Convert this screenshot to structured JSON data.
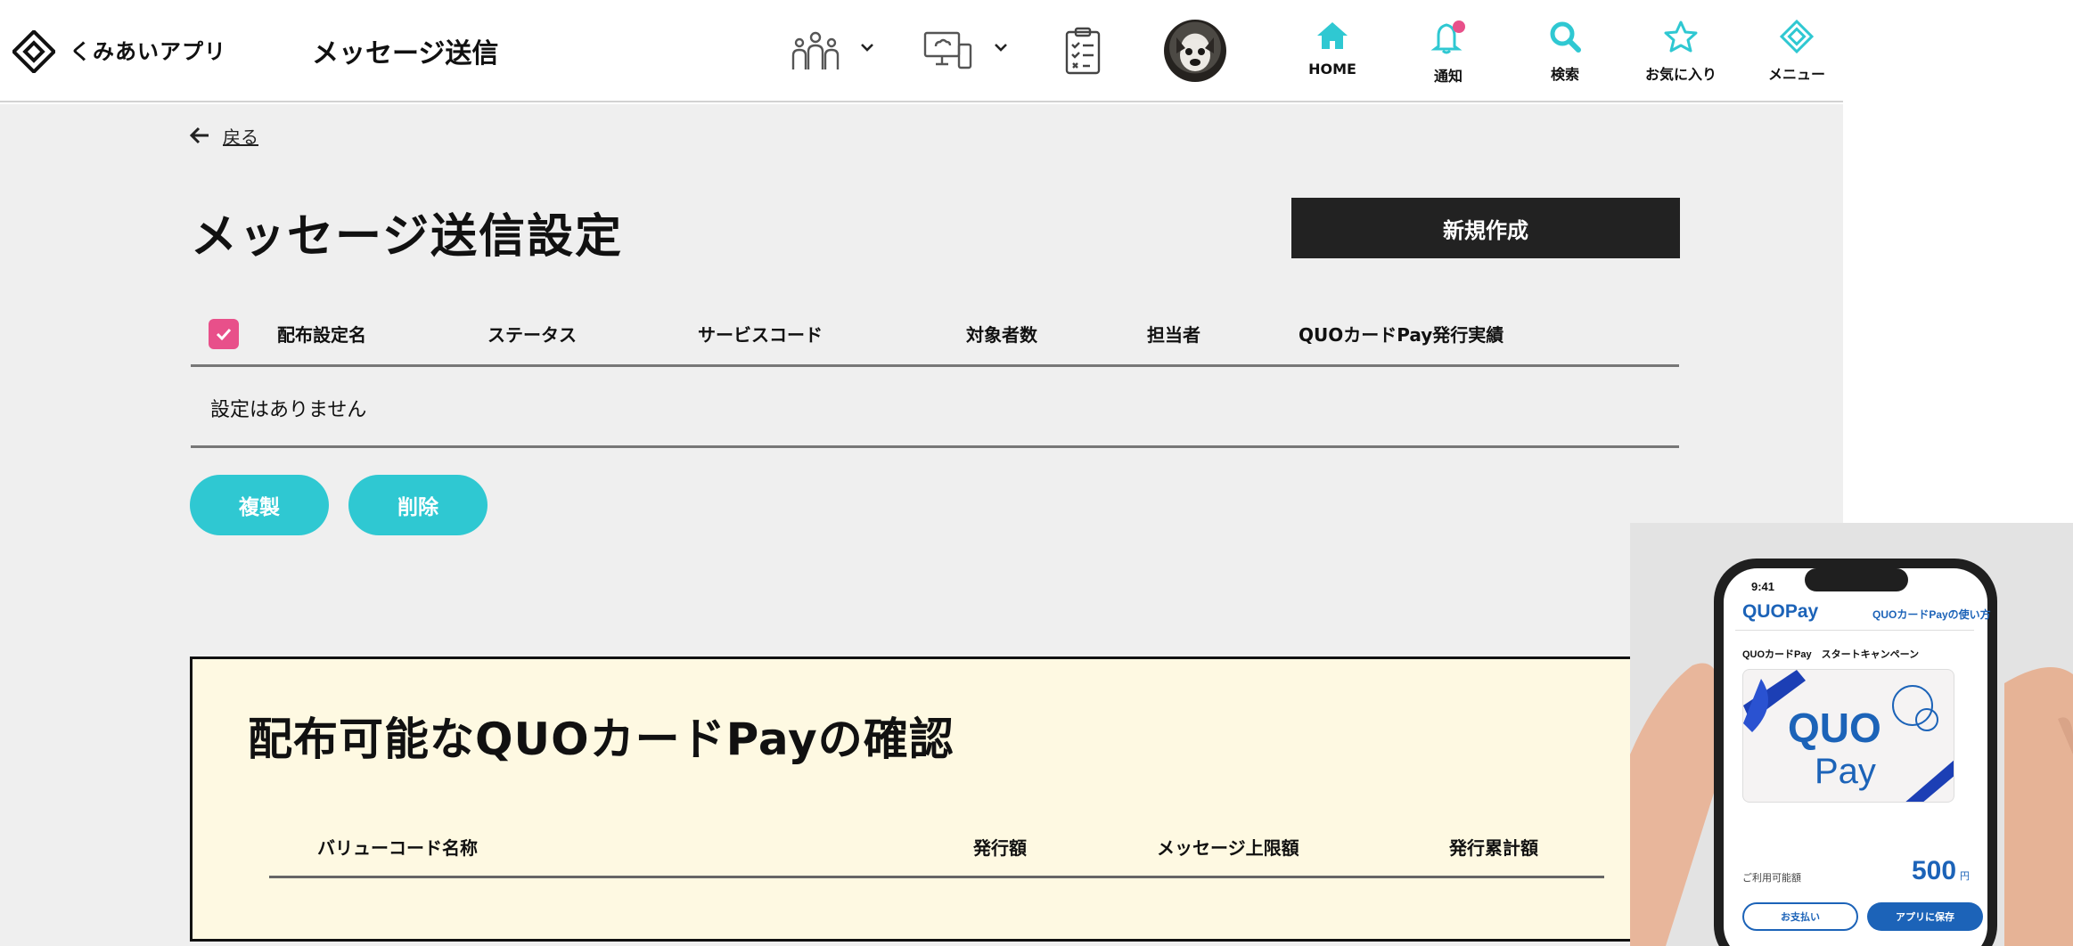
{
  "header": {
    "app_name": "くみあいアプリ",
    "page_title": "メッセージ送信",
    "nav": [
      {
        "label": "HOME",
        "icon": "home-icon"
      },
      {
        "label": "通知",
        "icon": "bell-icon"
      },
      {
        "label": "検索",
        "icon": "search-icon"
      },
      {
        "label": "お気に入り",
        "icon": "star-icon"
      },
      {
        "label": "メニュー",
        "icon": "menu-logo-icon"
      }
    ],
    "accent_color": "#2fc8d2",
    "badge_color": "#e8508a"
  },
  "main": {
    "back_label": "戻る",
    "title": "メッセージ送信設定",
    "new_button": "新規作成",
    "table": {
      "columns": [
        "配布設定名",
        "ステータス",
        "サービスコード",
        "対象者数",
        "担当者",
        "QUOカードPay発行実績"
      ],
      "empty_text": "設定はありません",
      "select_all_checked": true
    },
    "actions": {
      "duplicate": "複製",
      "delete": "削除"
    }
  },
  "quo_section": {
    "title": "配布可能なQUOカードPayの確認",
    "columns": [
      "バリューコード名称",
      "発行額",
      "メッセージ上限額",
      "発行累計額"
    ]
  },
  "promo": {
    "status_time": "9:41",
    "brand": "QUOPay",
    "help_link": "QUOカードPayの使い方",
    "campaign": "QUOカードPay　スタートキャンペーン",
    "card_brand_top": "QUO",
    "card_brand_bottom": "Pay",
    "balance_label": "ご利用可能額",
    "balance_value": "500",
    "balance_unit": "円",
    "pay_button": "お支払い",
    "save_button": "アプリに保存"
  }
}
